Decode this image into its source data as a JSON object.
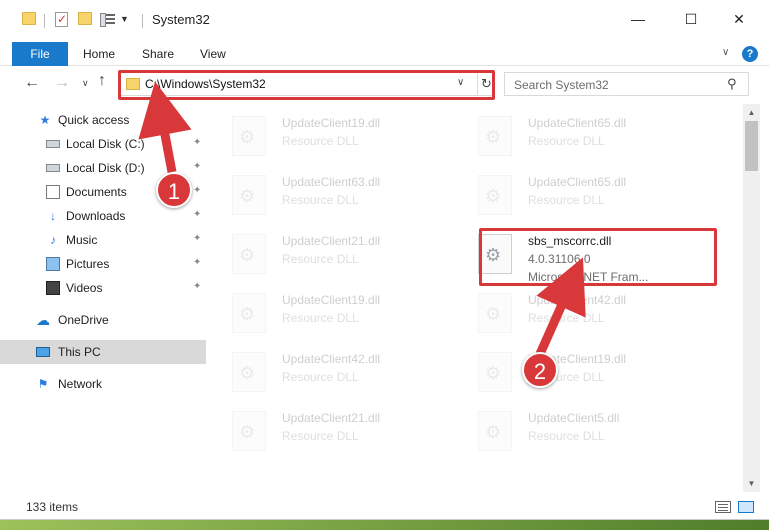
{
  "window": {
    "title": "System32",
    "min_glyph": "—",
    "max_glyph": "☐",
    "close_glyph": "✕"
  },
  "ribbon": {
    "file": "File",
    "home": "Home",
    "share": "Share",
    "view": "View",
    "help_glyph": "?",
    "chevron_glyph": "∨"
  },
  "nav": {
    "back_glyph": "←",
    "forward_glyph": "→",
    "recent_glyph": "∨",
    "up_glyph": "↑",
    "address": "C:\\Windows\\System32",
    "address_drop_glyph": "∨",
    "refresh_glyph": "↻",
    "search_placeholder": "Search System32",
    "search_glyph": "⚲"
  },
  "sidebar": {
    "items": [
      {
        "label": "Quick access",
        "icon": "star-icon",
        "glyph": "★",
        "pinned": false
      },
      {
        "label": "Local Disk (C:)",
        "icon": "disk-icon",
        "glyph": "",
        "pinned": true
      },
      {
        "label": "Local Disk (D:)",
        "icon": "disk-icon",
        "glyph": "",
        "pinned": true
      },
      {
        "label": "Documents",
        "icon": "documents-icon",
        "glyph": "",
        "pinned": true
      },
      {
        "label": "Downloads",
        "icon": "download-icon",
        "glyph": "↓",
        "pinned": true
      },
      {
        "label": "Music",
        "icon": "music-icon",
        "glyph": "♪",
        "pinned": true
      },
      {
        "label": "Pictures",
        "icon": "pictures-icon",
        "glyph": "",
        "pinned": true
      },
      {
        "label": "Videos",
        "icon": "videos-icon",
        "glyph": "",
        "pinned": true
      },
      {
        "label": "OneDrive",
        "icon": "cloud-icon",
        "glyph": "☁",
        "pinned": false
      },
      {
        "label": "This PC",
        "icon": "pc-icon",
        "glyph": "",
        "pinned": false,
        "selected": true
      },
      {
        "label": "Network",
        "icon": "network-icon",
        "glyph": "⚑",
        "pinned": false
      }
    ],
    "pin_glyph": "📌"
  },
  "files": [
    {
      "name": "UpdateClient19.dll",
      "line1": "Resource DLL",
      "line2": "",
      "faded": true
    },
    {
      "name": "UpdateClient65.dll",
      "line1": "Resource DLL",
      "line2": "",
      "faded": true
    },
    {
      "name": "UpdateClient63.dll",
      "line1": "Resource DLL",
      "line2": "",
      "faded": true
    },
    {
      "name": "UpdateClient65.dll",
      "line1": "Resource DLL",
      "line2": "",
      "faded": true
    },
    {
      "name": "UpdateClient21.dll",
      "line1": "Resource DLL",
      "line2": "",
      "faded": true
    },
    {
      "name": "sbs_mscorrc.dll",
      "line1": "4.0.31106.0",
      "line2": "Microsoft .NET Fram...",
      "faded": false
    },
    {
      "name": "UpdateClient19.dll",
      "line1": "Resource DLL",
      "line2": "",
      "faded": true
    },
    {
      "name": "UpdateClient42.dll",
      "line1": "Resource DLL",
      "line2": "",
      "faded": true
    },
    {
      "name": "UpdateClient42.dll",
      "line1": "Resource DLL",
      "line2": "",
      "faded": true
    },
    {
      "name": "UpdateClient19.dll",
      "line1": "Resource DLL",
      "line2": "",
      "faded": true
    },
    {
      "name": "UpdateClient21.dll",
      "line1": "Resource DLL",
      "line2": "",
      "faded": true
    },
    {
      "name": "UpdateClient5.dll",
      "line1": "Resource DLL",
      "line2": "",
      "faded": true
    }
  ],
  "status": {
    "count": "133 items"
  },
  "annotations": {
    "step1": "1",
    "step2": "2",
    "color": "#d9383a"
  },
  "colors": {
    "accent": "#1979ca",
    "highlight": "#d9383a"
  }
}
